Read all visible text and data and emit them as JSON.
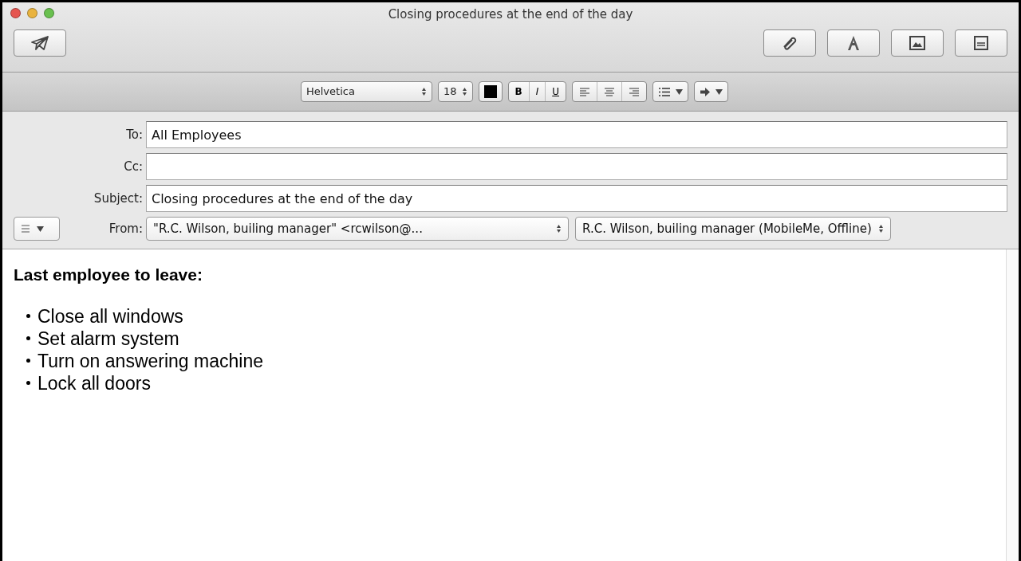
{
  "window": {
    "title": "Closing procedures at the end of the day"
  },
  "format_bar": {
    "font": "Helvetica",
    "size": "18",
    "styles": [
      "B",
      "I",
      "U"
    ]
  },
  "fields": [
    {
      "label": "To:",
      "value": "All Employees"
    },
    {
      "label": "Cc:"
    },
    {
      "label": "Subject:",
      "value": "Closing procedures at the end of the day"
    }
  ],
  "from": {
    "label": "From:",
    "address": "\"R.C. Wilson, builing manager\" <rcwilson@...",
    "account": "R.C. Wilson, builing manager (MobileMe, Offline)"
  },
  "body": {
    "heading": "Last employee to leave:",
    "items": [
      "Close all windows",
      "Set alarm system",
      "Turn on answering machine",
      "Lock all doors"
    ]
  }
}
